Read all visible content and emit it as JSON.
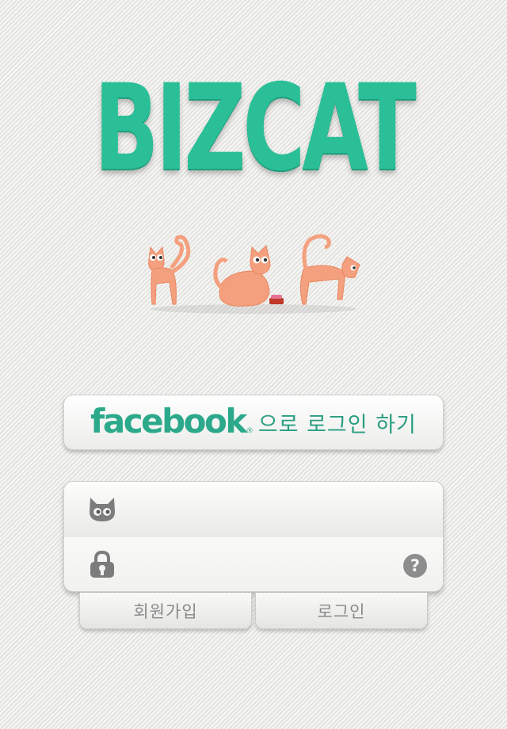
{
  "app": {
    "logo_text": "BIZCAT"
  },
  "colors": {
    "brand": "#2bbf98",
    "cat": "#f4a07e"
  },
  "illustration": {
    "icon": "three-cats-illustration"
  },
  "facebook_login": {
    "brand_word": "facebook",
    "registered_mark": "®",
    "suffix": "으로 로그인 하기"
  },
  "form": {
    "id_field": {
      "icon": "cat-face-icon",
      "value": ""
    },
    "password_field": {
      "icon": "lock-icon",
      "value": "",
      "help_icon": "question-mark-icon"
    }
  },
  "actions": {
    "signup_label": "회원가입",
    "login_label": "로그인"
  }
}
